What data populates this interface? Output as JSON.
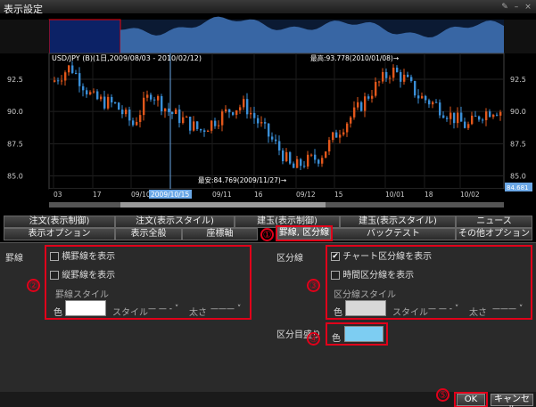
{
  "window": {
    "title": "表示設定"
  },
  "chart": {
    "header": "USD/JPY (B)(1日,2009/08/03 - 2010/02/12)",
    "high_label": "最高:93.778(2010/01/08)→",
    "low_label": "最安:84.769(2009/11/27)→",
    "y_ticks": [
      "92.5",
      "90.0",
      "87.5",
      "85.0"
    ],
    "x_ticks": [
      "03",
      "17",
      "09/10",
      "09/11",
      "16",
      "09/12",
      "15",
      "10/01",
      "18",
      "10/02"
    ],
    "crosshair_date": "2009/10/15",
    "crosshair_price": "84.681"
  },
  "tabs_row1": [
    "注文(表示制御)",
    "注文(表示スタイル)",
    "建玉(表示制御)",
    "建玉(表示スタイル)",
    "ニュース"
  ],
  "tabs_row2": [
    "表示オプション",
    "表示全般",
    "座標軸",
    "罫線, 区分線",
    "バックテスト",
    "その他オプション"
  ],
  "left": {
    "section": "罫線",
    "cb1": "横罫線を表示",
    "cb2": "縦罫線を表示",
    "style_title": "罫線スタイル",
    "color_label": "色",
    "style_label": "スタイル",
    "style_value": "— — - ˅",
    "width_label": "太さ",
    "width_value": "——— ˅",
    "color": "#ffffff"
  },
  "right": {
    "section": "区分線",
    "cb1": "チャート区分線を表示",
    "cb2": "時間区分線を表示",
    "cb1_checked": "✔",
    "style_title": "区分線スタイル",
    "color_label": "色",
    "style_label": "スタイル",
    "style_value": "— — - ˅",
    "width_label": "太さ",
    "width_value": "——— ˅",
    "color": "#d8d8d8",
    "fill_section": "区分目盛り",
    "fill_color_label": "色",
    "fill_color": "#7dcdf2"
  },
  "markers": [
    "①",
    "②",
    "③",
    "④",
    "⑤"
  ],
  "buttons": {
    "ok": "OK",
    "cancel": "キャンセル"
  }
}
